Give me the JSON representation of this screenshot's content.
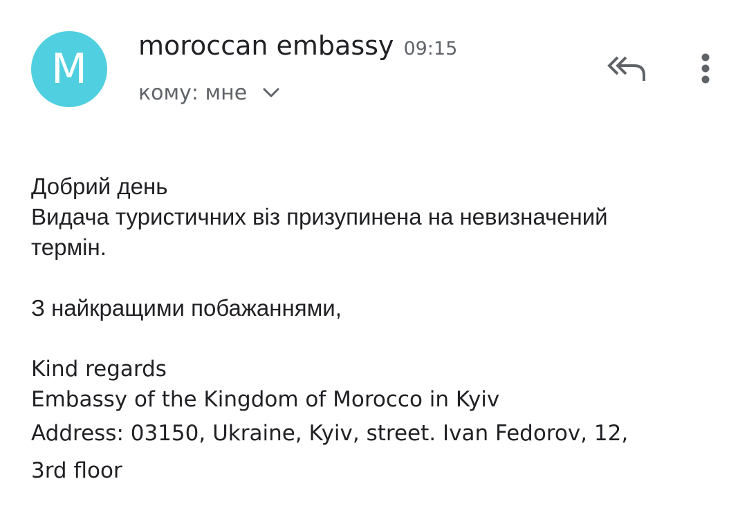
{
  "sender": {
    "avatar_letter": "M",
    "avatar_color": "#4fcfdf",
    "name": "moroccan embassy",
    "time": "09:15"
  },
  "recipient": {
    "label": "кому: мне"
  },
  "icons": {
    "reply_all": "reply-all-icon",
    "more": "more-vert-icon",
    "expand": "chevron-down-icon"
  },
  "message": {
    "greeting": "Добрий день",
    "line1": "Видача туристичних віз призупинена на невизначений",
    "line2": "термін.",
    "closing_ua": "З найкращими побажаннями,",
    "closing_en": "Kind regards",
    "org": "Embassy of the Kingdom of Morocco in Kyiv",
    "address_line1": "Address: 03150, Ukraine, Kyiv, street. Ivan Fedorov, 12,",
    "address_line2": "3rd floor"
  }
}
